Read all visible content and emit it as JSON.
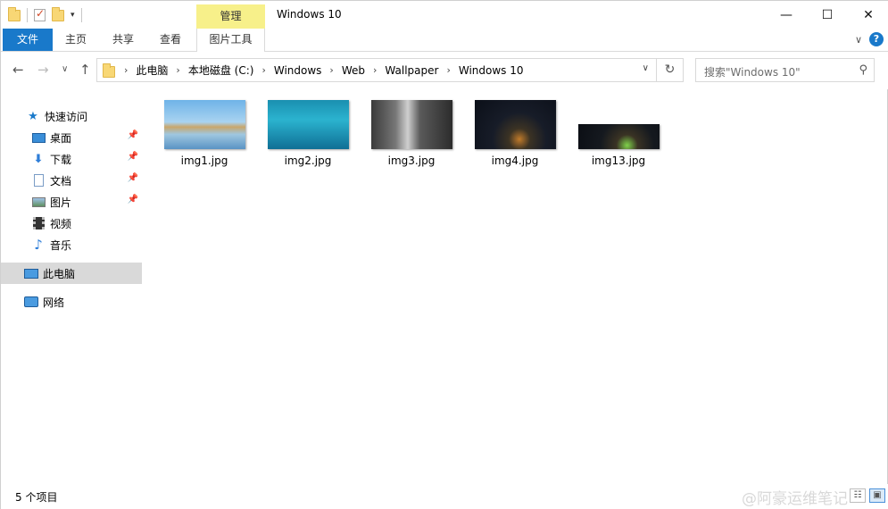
{
  "window": {
    "title": "Windows 10",
    "minimize_glyph": "—",
    "maximize_glyph": "☐",
    "close_glyph": "✕"
  },
  "title_bar": {
    "contextual_tab": "管理"
  },
  "ribbon": {
    "tabs": [
      {
        "label": "文件",
        "active": true
      },
      {
        "label": "主页"
      },
      {
        "label": "共享"
      },
      {
        "label": "查看"
      },
      {
        "label": "图片工具"
      }
    ],
    "help_label": "?"
  },
  "address_bar": {
    "crumbs": [
      "此电脑",
      "本地磁盘 (C:)",
      "Windows",
      "Web",
      "Wallpaper",
      "Windows 10"
    ]
  },
  "search": {
    "placeholder": "搜索\"Windows 10\""
  },
  "nav_pane": {
    "quick_access": "快速访问",
    "items": [
      {
        "label": "桌面",
        "icon": "desktop-icon",
        "pinned": true
      },
      {
        "label": "下载",
        "icon": "download-icon",
        "pinned": true
      },
      {
        "label": "文档",
        "icon": "documents-icon",
        "pinned": true
      },
      {
        "label": "图片",
        "icon": "pictures-icon",
        "pinned": true
      },
      {
        "label": "视频",
        "icon": "videos-icon"
      },
      {
        "label": "音乐",
        "icon": "music-icon"
      }
    ],
    "this_pc": "此电脑",
    "network": "网络"
  },
  "files": [
    {
      "name": "img1.jpg",
      "thumb": "beach-rocks"
    },
    {
      "name": "img2.jpg",
      "thumb": "underwater-swimmer"
    },
    {
      "name": "img3.jpg",
      "thumb": "waterfall-cliff"
    },
    {
      "name": "img4.jpg",
      "thumb": "milky-way-tent"
    },
    {
      "name": "img13.jpg",
      "thumb": "milky-way-tent-wide"
    }
  ],
  "status_bar": {
    "item_count": "5 个项目",
    "watermark": "@阿豪运维笔记"
  },
  "colors": {
    "file_tab": "#1979ca",
    "manage_tab": "#f7f08a",
    "selected_nav": "#d9d9d9"
  }
}
